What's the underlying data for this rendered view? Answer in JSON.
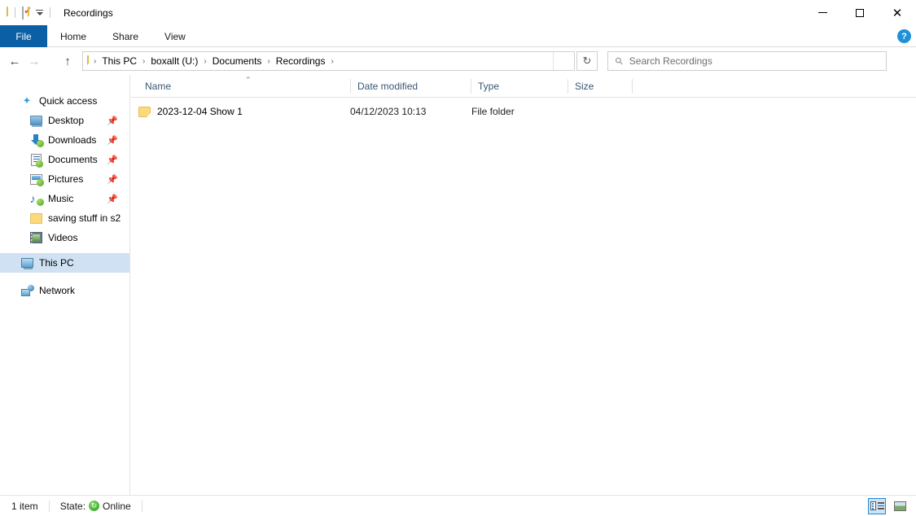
{
  "window": {
    "title": "Recordings",
    "quick_access": [
      {
        "name": "folder-icon",
        "label": "Folder"
      },
      {
        "name": "properties-icon",
        "label": "Properties"
      },
      {
        "name": "new-folder-icon",
        "label": "New folder"
      },
      {
        "name": "customize-quick-access-icon",
        "label": "Customize Quick Access Toolbar"
      }
    ],
    "controls": {
      "minimize": "—",
      "maximize": "",
      "close": "✕"
    }
  },
  "ribbon": {
    "tabs": [
      {
        "label": "File",
        "active": true
      },
      {
        "label": "Home",
        "active": false
      },
      {
        "label": "Share",
        "active": false
      },
      {
        "label": "View",
        "active": false
      }
    ],
    "expand_chevron": "ⱟ",
    "help_label": "?"
  },
  "navigation": {
    "back": "←",
    "forward": "→",
    "recent": "ⱟ",
    "up": "↑",
    "refresh": "↻",
    "address_dropdown": "ⱟ"
  },
  "address": {
    "crumbs": [
      "This PC",
      "boxallt (U:)",
      "Documents",
      "Recordings"
    ],
    "separator": "›",
    "trailing_separator": "›"
  },
  "search": {
    "placeholder": "Search Recordings",
    "value": "",
    "icon": "search-icon"
  },
  "sidebar": {
    "items": [
      {
        "label": "Quick access",
        "icon": "star-icon",
        "pinned": false,
        "indent": false,
        "selected": false
      },
      {
        "label": "Desktop",
        "icon": "desktop-icon",
        "pinned": true,
        "indent": true,
        "selected": false
      },
      {
        "label": "Downloads",
        "icon": "downloads-icon",
        "pinned": true,
        "indent": true,
        "selected": false
      },
      {
        "label": "Documents",
        "icon": "documents-icon",
        "pinned": true,
        "indent": true,
        "selected": false
      },
      {
        "label": "Pictures",
        "icon": "pictures-icon",
        "pinned": true,
        "indent": true,
        "selected": false
      },
      {
        "label": "Music",
        "icon": "music-icon",
        "pinned": true,
        "indent": true,
        "selected": false
      },
      {
        "label": "saving stuff in s2",
        "icon": "folder-icon",
        "pinned": false,
        "indent": true,
        "selected": false
      },
      {
        "label": "Videos",
        "icon": "videos-icon",
        "pinned": false,
        "indent": true,
        "selected": false
      },
      {
        "label": "This PC",
        "icon": "this-pc-icon",
        "pinned": false,
        "indent": false,
        "selected": true
      },
      {
        "label": "Network",
        "icon": "network-icon",
        "pinned": false,
        "indent": false,
        "selected": false
      }
    ],
    "pin_glyph": "📌"
  },
  "file_list": {
    "columns": [
      {
        "label": "Name",
        "sorted": "asc",
        "sort_glyph": "⌃"
      },
      {
        "label": "Date modified",
        "sorted": "",
        "sort_glyph": ""
      },
      {
        "label": "Type",
        "sorted": "",
        "sort_glyph": ""
      },
      {
        "label": "Size",
        "sorted": "",
        "sort_glyph": ""
      }
    ],
    "rows": [
      {
        "name": "2023-12-04 Show 1",
        "date_modified": "04/12/2023 10:13",
        "type": "File folder",
        "size": "",
        "icon": "folder-icon",
        "selected": false
      }
    ]
  },
  "status_bar": {
    "item_count": "1 item",
    "state_label": "State:",
    "state_value": "Online",
    "state_icon": "sync-online-icon",
    "views": [
      {
        "name": "details-view-button",
        "label": "Details view",
        "active": true
      },
      {
        "name": "large-icons-view-button",
        "label": "Large icons view",
        "active": false
      }
    ]
  },
  "colors": {
    "accent": "#0b5fa5",
    "selection": "#cfe1f3",
    "folder_yellow": "#fdd97c",
    "online_green": "#2f9e2f",
    "header_text": "#3a5673"
  }
}
